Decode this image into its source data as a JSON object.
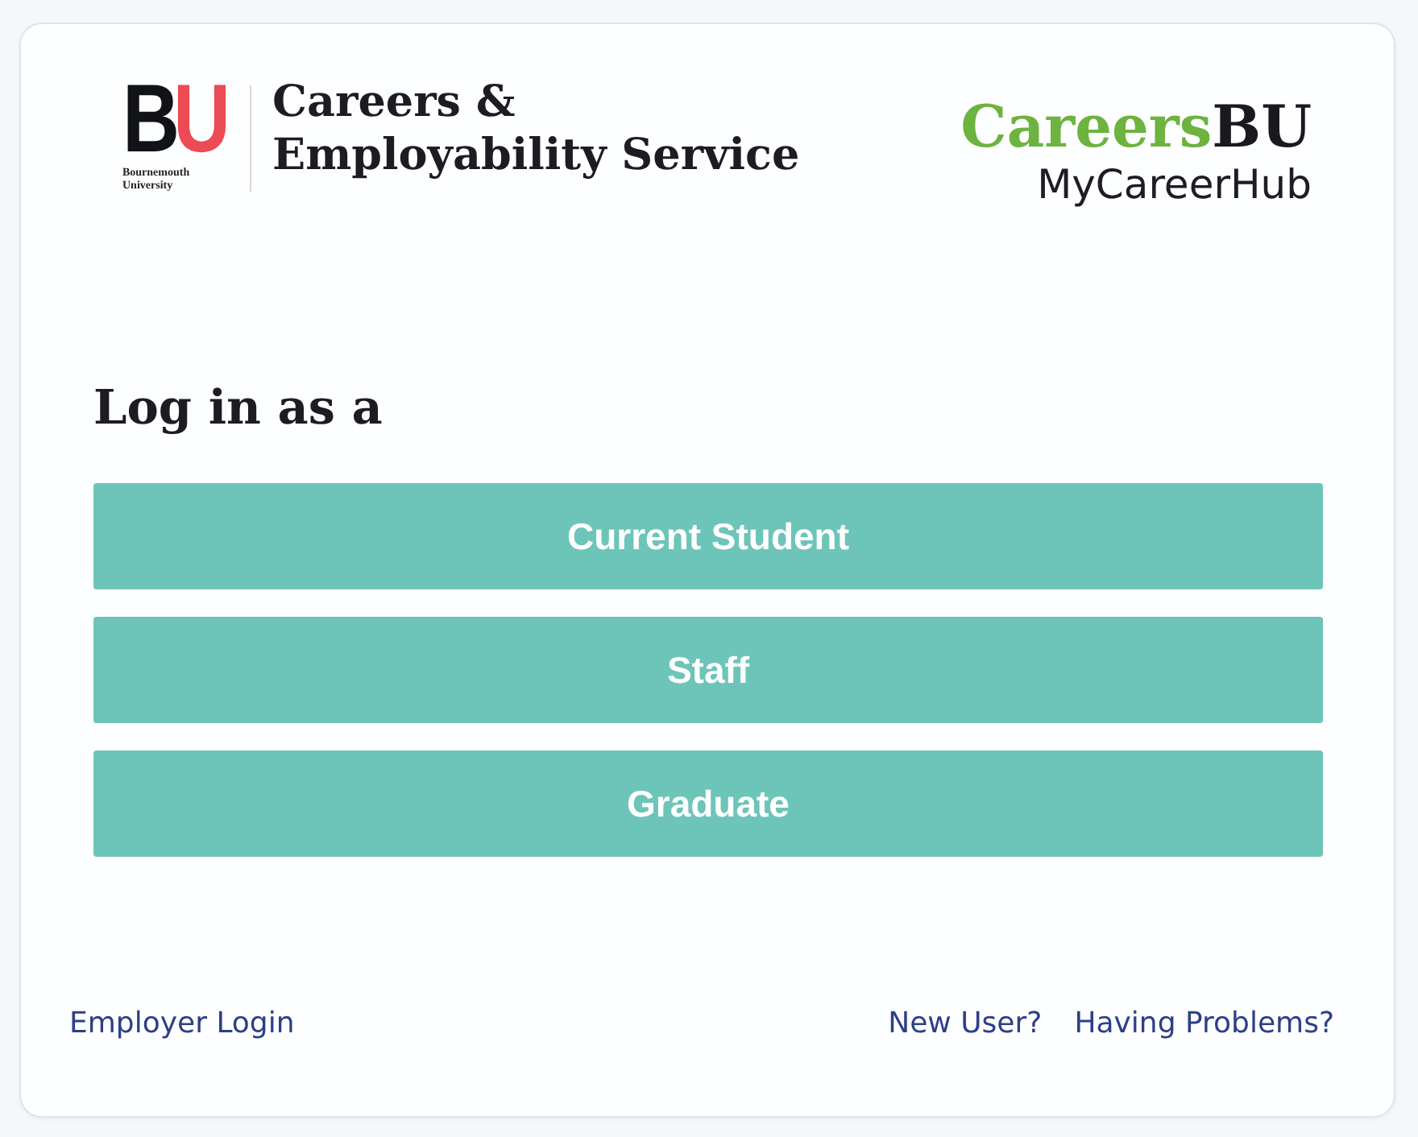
{
  "header": {
    "logo": {
      "letters": [
        "B",
        "U"
      ],
      "caption": "Bournemouth University"
    },
    "title": "Careers & Employability Service",
    "brand": {
      "name_parts": [
        "Careers",
        "BU"
      ],
      "subtitle": "MyCareerHub"
    }
  },
  "login": {
    "heading": "Log in as a",
    "buttons": [
      "Current Student",
      "Staff",
      "Graduate"
    ]
  },
  "footer": {
    "left_links": [
      "Employer Login"
    ],
    "right_links": [
      "New User?",
      "Having Problems?"
    ]
  }
}
